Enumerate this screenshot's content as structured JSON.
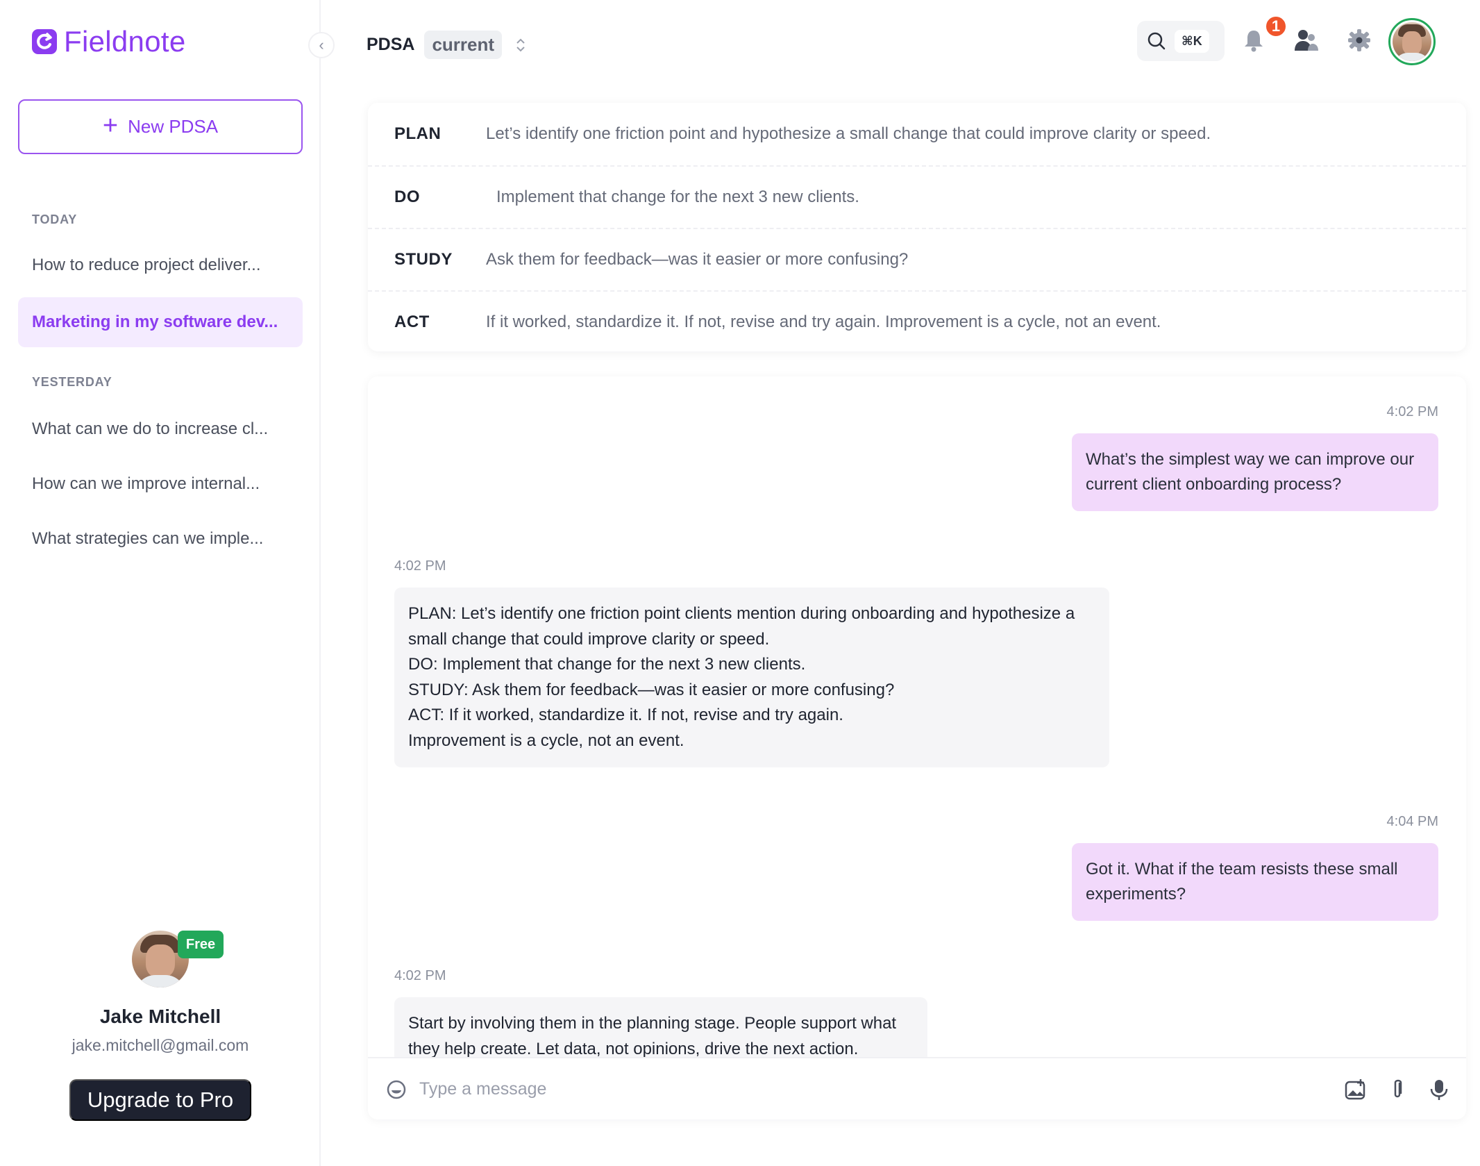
{
  "app": {
    "name": "Fieldnote"
  },
  "sidebar": {
    "new_button_label": "New PDSA",
    "sections": [
      {
        "label": "TODAY",
        "items": [
          "How to reduce project deliver...",
          "Marketing in my software dev..."
        ]
      },
      {
        "label": "YESTERDAY",
        "items": [
          "What can we do to increase cl...",
          "How can we improve internal...",
          "What strategies can we imple..."
        ]
      }
    ],
    "active_item": "Marketing in my software dev...",
    "profile": {
      "plan_badge": "Free",
      "name": "Jake Mitchell",
      "email": "jake.mitchell@gmail.com",
      "upgrade_label": "Upgrade to Pro"
    }
  },
  "header": {
    "title": "PDSA",
    "version_pill": "current",
    "search_shortcut": "⌘K",
    "notification_count": "1"
  },
  "pdsa": {
    "rows": [
      {
        "key": "PLAN",
        "value": "Let’s identify one friction point and hypothesize a small change that could improve clarity or speed."
      },
      {
        "key": "DO",
        "value": "Implement that change for the next 3 new clients."
      },
      {
        "key": "STUDY",
        "value": "Ask them for feedback—was it easier or more confusing?"
      },
      {
        "key": "ACT",
        "value": "If it worked, standardize it. If not, revise and try again. Improvement is a cycle, not an event."
      }
    ]
  },
  "chat": {
    "messages": [
      {
        "role": "user",
        "time": "4:02 PM",
        "lines": [
          "What’s the simplest way we can improve our",
          "current client onboarding process?"
        ]
      },
      {
        "role": "assistant",
        "time": "4:02 PM",
        "lines": [
          "PLAN: Let’s identify one friction point clients mention during onboarding and hypothesize a",
          "small change that could improve clarity or speed.",
          "DO: Implement that change for the next 3 new clients.",
          "STUDY: Ask them for feedback—was it easier or more confusing?",
          "ACT: If it worked, standardize it. If not, revise and try again.",
          "Improvement is a cycle, not an event."
        ]
      },
      {
        "role": "user",
        "time": "4:04 PM",
        "lines": [
          "Got it. What if the team resists these small",
          "experiments?"
        ]
      },
      {
        "role": "assistant",
        "time": "4:02 PM",
        "lines": [
          "Start by involving them in the planning stage. People support what",
          "they help create. Let data, not opinions, drive the next action."
        ]
      }
    ],
    "composer_placeholder": "Type a message"
  },
  "colors": {
    "brand": "#8b3cf0",
    "active_bg": "#f4ebff",
    "user_bubble": "#f2d9fb",
    "free_badge": "#22a85a",
    "notif_badge": "#f0552b",
    "upgrade_bg": "#1e2230"
  },
  "icons": [
    "logo-mark-icon",
    "chevron-left-icon",
    "plus-icon",
    "sort-icon",
    "search-icon",
    "bell-icon",
    "users-icon",
    "gear-icon",
    "emoji-icon",
    "image-add-icon",
    "paperclip-icon",
    "microphone-icon"
  ]
}
